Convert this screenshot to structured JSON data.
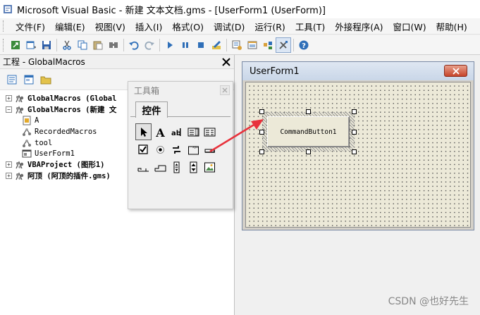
{
  "window": {
    "title": "Microsoft Visual Basic - 新建 文本文档.gms - [UserForm1 (UserForm)]"
  },
  "menu": [
    {
      "label": "文件(F)",
      "name": "menu-file"
    },
    {
      "label": "编辑(E)",
      "name": "menu-edit"
    },
    {
      "label": "视图(V)",
      "name": "menu-view"
    },
    {
      "label": "插入(I)",
      "name": "menu-insert"
    },
    {
      "label": "格式(O)",
      "name": "menu-format"
    },
    {
      "label": "调试(D)",
      "name": "menu-debug"
    },
    {
      "label": "运行(R)",
      "name": "menu-run"
    },
    {
      "label": "工具(T)",
      "name": "menu-tools"
    },
    {
      "label": "外接程序(A)",
      "name": "menu-addins"
    },
    {
      "label": "窗口(W)",
      "name": "menu-window"
    },
    {
      "label": "帮助(H)",
      "name": "menu-help"
    }
  ],
  "project": {
    "header": "工程 - GlobalMacros",
    "close_glyph": "✕",
    "tree": [
      {
        "label": "GlobalMacros (Global",
        "bold": true,
        "expander": "+",
        "icon": "project-icon",
        "indent": 0
      },
      {
        "label": "GlobalMacros (新建 文",
        "bold": true,
        "expander": "−",
        "icon": "project-icon",
        "indent": 0
      },
      {
        "label": "A",
        "bold": false,
        "expander": "",
        "icon": "document-icon",
        "indent": 1
      },
      {
        "label": "RecordedMacros",
        "bold": false,
        "expander": "",
        "icon": "module-icon",
        "indent": 1
      },
      {
        "label": "tool",
        "bold": false,
        "expander": "",
        "icon": "module-icon",
        "indent": 1
      },
      {
        "label": "UserForm1",
        "bold": false,
        "expander": "",
        "icon": "form-icon",
        "indent": 1
      },
      {
        "label": "VBAProject (图形1)",
        "bold": true,
        "expander": "+",
        "icon": "project-icon",
        "indent": 0
      },
      {
        "label": "阿顶 (阿顶的插件.gms)",
        "bold": true,
        "expander": "+",
        "icon": "project-icon",
        "indent": 0
      }
    ]
  },
  "toolbox": {
    "title": "工具箱",
    "tab_label": "控件",
    "close_glyph": "✕",
    "tools": [
      "pointer-icon",
      "label-icon",
      "textbox-icon",
      "combobox-icon",
      "listbox-icon",
      "checkbox-icon",
      "optionbutton-icon",
      "togglebutton-icon",
      "frame-icon",
      "commandbutton-icon",
      "tabstrip-icon",
      "multipage-icon",
      "scrollbar-icon",
      "spinbutton-icon",
      "image-icon"
    ]
  },
  "userform": {
    "title": "UserForm1",
    "close_glyph": "✕",
    "command_button_label": "CommandButton1"
  },
  "watermark": "CSDN @也好先生",
  "colors": {
    "arrow": "#e8323c",
    "uf_close": "#c6442a",
    "icon_blue": "#2f6fb8"
  }
}
